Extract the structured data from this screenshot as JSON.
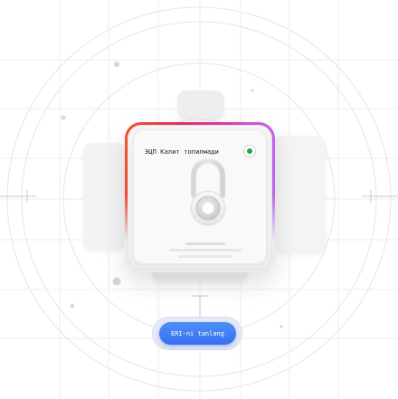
{
  "card": {
    "title": "ЭЦП Калит топилмади",
    "status": "connected",
    "status_color": "#1ea84a"
  },
  "action": {
    "select_key_label": "ERI-ni tanlang"
  },
  "colors": {
    "button_blue": "#3d7ff5",
    "card_border_gradient": [
      "#f2552c",
      "#e7305a",
      "#d839a3",
      "#c55ce6",
      "#b66ff0"
    ],
    "background": "#ffffff",
    "lock_shackle": "#e2e2e5"
  },
  "icons": {
    "center": "padlock-icon",
    "status": "status-dot-icon"
  }
}
